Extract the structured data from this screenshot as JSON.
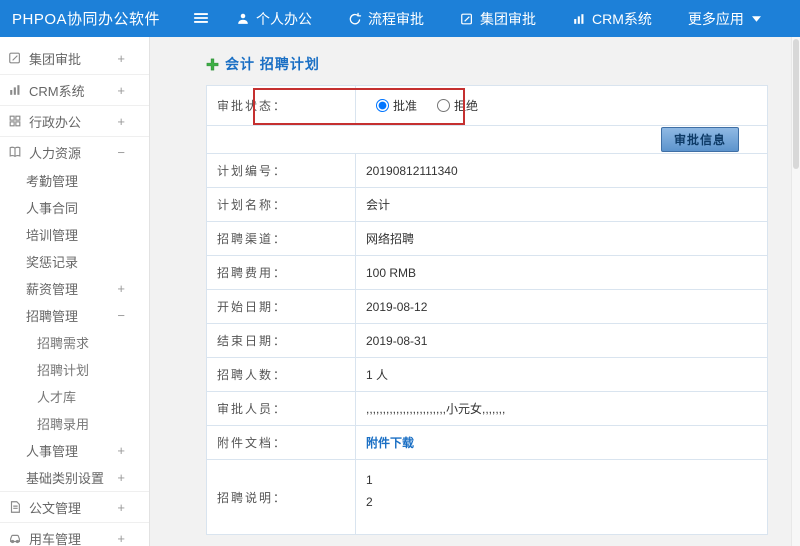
{
  "colors": {
    "topbar_blue": "#1d80d8",
    "title_blue": "#1a6fc4",
    "link_blue": "#1a6fc4",
    "annotation_red": "#c53030",
    "plus_green": "#3db045",
    "button_blue": "#5d94cd"
  },
  "topbar": {
    "brand": "PHPOA协同办公软件",
    "items": [
      {
        "label": "个人办公",
        "icon": "person-icon"
      },
      {
        "label": "流程审批",
        "icon": "process-icon"
      },
      {
        "label": "集团审批",
        "icon": "edit-icon"
      },
      {
        "label": "CRM系统",
        "icon": "chart-icon"
      },
      {
        "label": "更多应用",
        "icon": "caret-down-icon"
      }
    ]
  },
  "sidebar": {
    "items": [
      {
        "label": "集团审批",
        "toggle": "+"
      },
      {
        "label": "CRM系统",
        "toggle": "+"
      },
      {
        "label": "行政办公",
        "toggle": "+"
      },
      {
        "label": "人力资源",
        "toggle": "−"
      },
      {
        "label": "考勤管理",
        "toggle": ""
      },
      {
        "label": "人事合同",
        "toggle": ""
      },
      {
        "label": "培训管理",
        "toggle": ""
      },
      {
        "label": "奖惩记录",
        "toggle": ""
      },
      {
        "label": "薪资管理",
        "toggle": "+"
      },
      {
        "label": "招聘管理",
        "toggle": "−"
      },
      {
        "label": "招聘需求",
        "toggle": ""
      },
      {
        "label": "招聘计划",
        "toggle": ""
      },
      {
        "label": "人才库",
        "toggle": ""
      },
      {
        "label": "招聘录用",
        "toggle": ""
      },
      {
        "label": "人事管理",
        "toggle": "+"
      },
      {
        "label": "基础类别设置",
        "toggle": "+"
      },
      {
        "label": "公文管理",
        "toggle": "+"
      },
      {
        "label": "用车管理",
        "toggle": "+"
      }
    ]
  },
  "main": {
    "title": "会计 招聘计划",
    "approve": {
      "label": "审批状态：",
      "options": [
        {
          "label": "批准",
          "checked": true
        },
        {
          "label": "拒绝",
          "checked": false
        }
      ]
    },
    "button_label": "审批信息",
    "rows": [
      {
        "label": "计划编号：",
        "value": "20190812111340"
      },
      {
        "label": "计划名称：",
        "value": "会计"
      },
      {
        "label": "招聘渠道：",
        "value": "网络招聘"
      },
      {
        "label": "招聘费用：",
        "value": "100 RMB"
      },
      {
        "label": "开始日期：",
        "value": "2019-08-12"
      },
      {
        "label": "结束日期：",
        "value": "2019-08-31"
      },
      {
        "label": "招聘人数：",
        "value": "1 人"
      },
      {
        "label": "审批人员：",
        "value": ",,,,,,,,,,,,,,,,,,,,,,,,小元女,,,,,,,"
      },
      {
        "label": "附件文档：",
        "value": "附件下载"
      },
      {
        "label": "招聘说明：",
        "lines": [
          "1",
          "2"
        ]
      }
    ]
  }
}
